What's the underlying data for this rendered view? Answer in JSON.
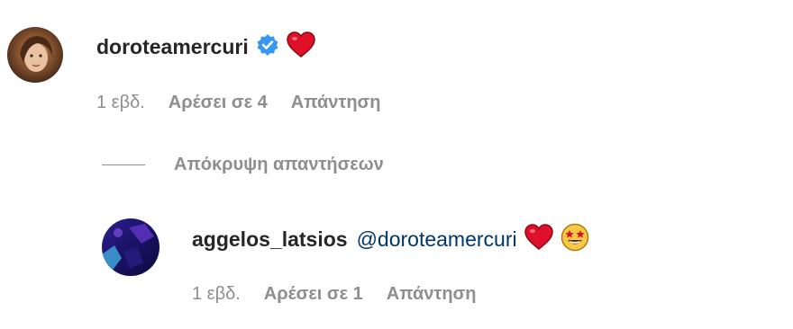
{
  "comment": {
    "username": "doroteamercuri",
    "verified": true,
    "emojis": [
      "red-heart"
    ],
    "time": "1 εβδ.",
    "likes": "Αρέσει σε 4",
    "reply": "Απάντηση"
  },
  "hide_replies": "Απόκρυψη απαντήσεων",
  "reply_comment": {
    "username": "aggelos_latsios",
    "mention": "@doroteamercuri",
    "emojis": [
      "red-heart",
      "star-struck"
    ],
    "time": "1 εβδ.",
    "likes": "Αρέσει σε 1",
    "reply": "Απάντηση"
  },
  "colors": {
    "text": "#262626",
    "secondary": "#8e8e8e",
    "mention": "#00376b",
    "verified": "#3897f0",
    "heart": "#e0102a"
  }
}
